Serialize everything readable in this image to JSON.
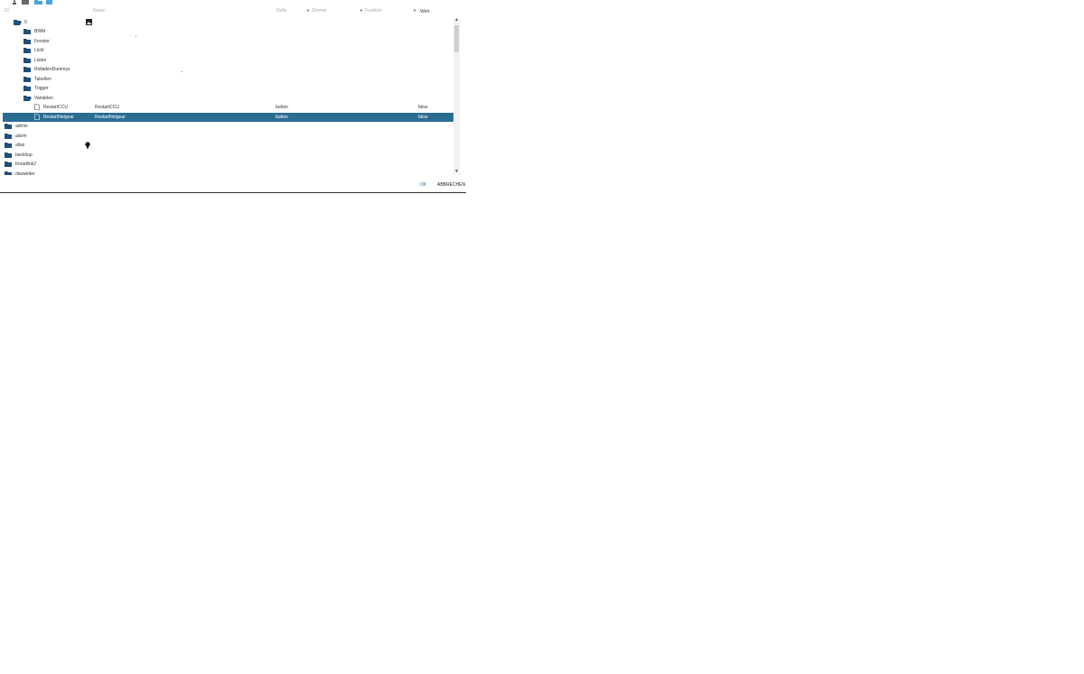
{
  "columns": {
    "id": "ID",
    "name": "Name",
    "rolle": "Rolle",
    "zimmer": "Zimmer",
    "funktion": "Funktion",
    "wert": "Wert"
  },
  "tree": {
    "root": "0",
    "folders": [
      "BWM",
      "Fenster",
      "Licht",
      "Listen",
      "RolladenDummys",
      "Tabellen",
      "Trigger"
    ],
    "open_folder": "Variablen",
    "states": [
      {
        "id": "RestartCCU",
        "name": "RestartCCU",
        "role": "button",
        "value": "false"
      },
      {
        "id": "RestartNetgear",
        "name": "RestartNetgear",
        "role": "button",
        "value": "false"
      }
    ],
    "top_level": [
      "admin",
      "alarm",
      "alias",
      "backitup",
      "broadlink2",
      "daswetter"
    ]
  },
  "footer": {
    "ok": "OK",
    "cancel": "ABBRECHEN"
  },
  "colors": {
    "accent": "#2a6d92",
    "folder": "#1f4e79",
    "toolbar_blue": "#4aa3df"
  }
}
